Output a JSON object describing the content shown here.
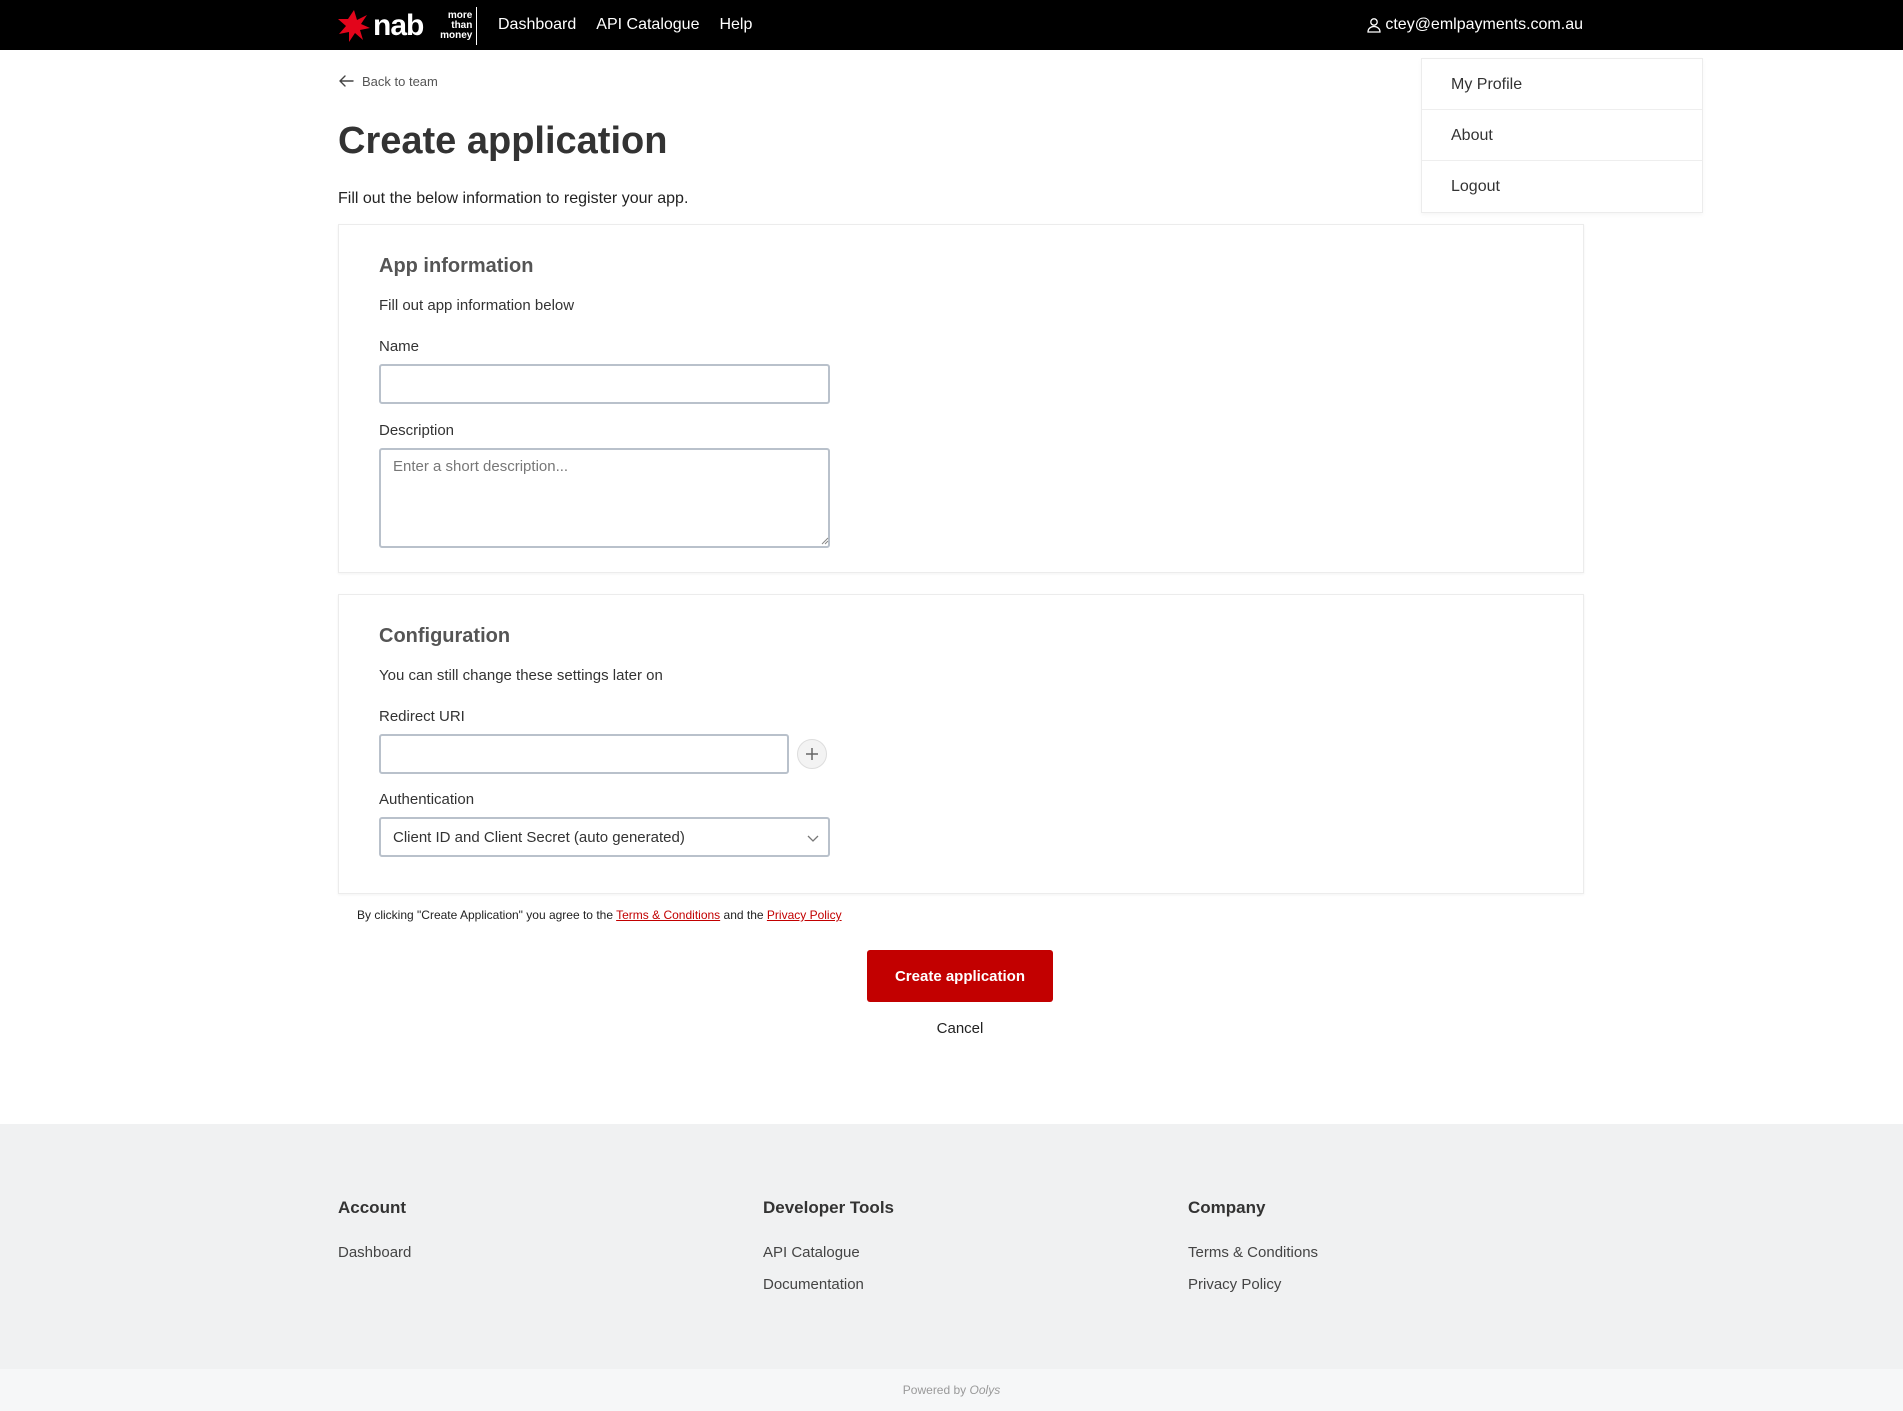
{
  "brand": {
    "logo_word": "nab",
    "logo_tagline_1": "more",
    "logo_tagline_2": "than",
    "logo_tagline_3": "money",
    "accent_color": "#c20000"
  },
  "nav": {
    "items": [
      {
        "label": "Dashboard"
      },
      {
        "label": "API Catalogue"
      },
      {
        "label": "Help"
      }
    ],
    "user_email": "ctey@emlpayments.com.au",
    "user_icon": "user-icon"
  },
  "user_dropdown": {
    "items": [
      {
        "label": "My Profile"
      },
      {
        "label": "About"
      },
      {
        "label": "Logout"
      }
    ]
  },
  "page": {
    "back_label": "Back to team",
    "title": "Create application",
    "subtitle": "Fill out the below information to register your app."
  },
  "app_info": {
    "title": "App information",
    "description": "Fill out app information below",
    "name_label": "Name",
    "name_value": "",
    "description_label": "Description",
    "description_placeholder": "Enter a short description..."
  },
  "configuration": {
    "title": "Configuration",
    "description": "You can still change these settings later on",
    "redirect_label": "Redirect URI",
    "redirect_value": "",
    "auth_label": "Authentication",
    "auth_selected": "Client ID and Client Secret (auto generated)"
  },
  "agreement": {
    "prefix": "By clicking \"Create Application\" you agree to the",
    "terms_link": "Terms & Conditions",
    "middle": "and the",
    "privacy_link": "Privacy Policy"
  },
  "actions": {
    "create_label": "Create application",
    "cancel_label": "Cancel"
  },
  "footer": {
    "columns": [
      {
        "heading": "Account",
        "links": [
          "Dashboard"
        ]
      },
      {
        "heading": "Developer Tools",
        "links": [
          "API Catalogue",
          "Documentation"
        ]
      },
      {
        "heading": "Company",
        "links": [
          "Terms & Conditions",
          "Privacy Policy"
        ]
      }
    ],
    "powered_prefix": "Powered by",
    "powered_brand": "Oolys"
  }
}
